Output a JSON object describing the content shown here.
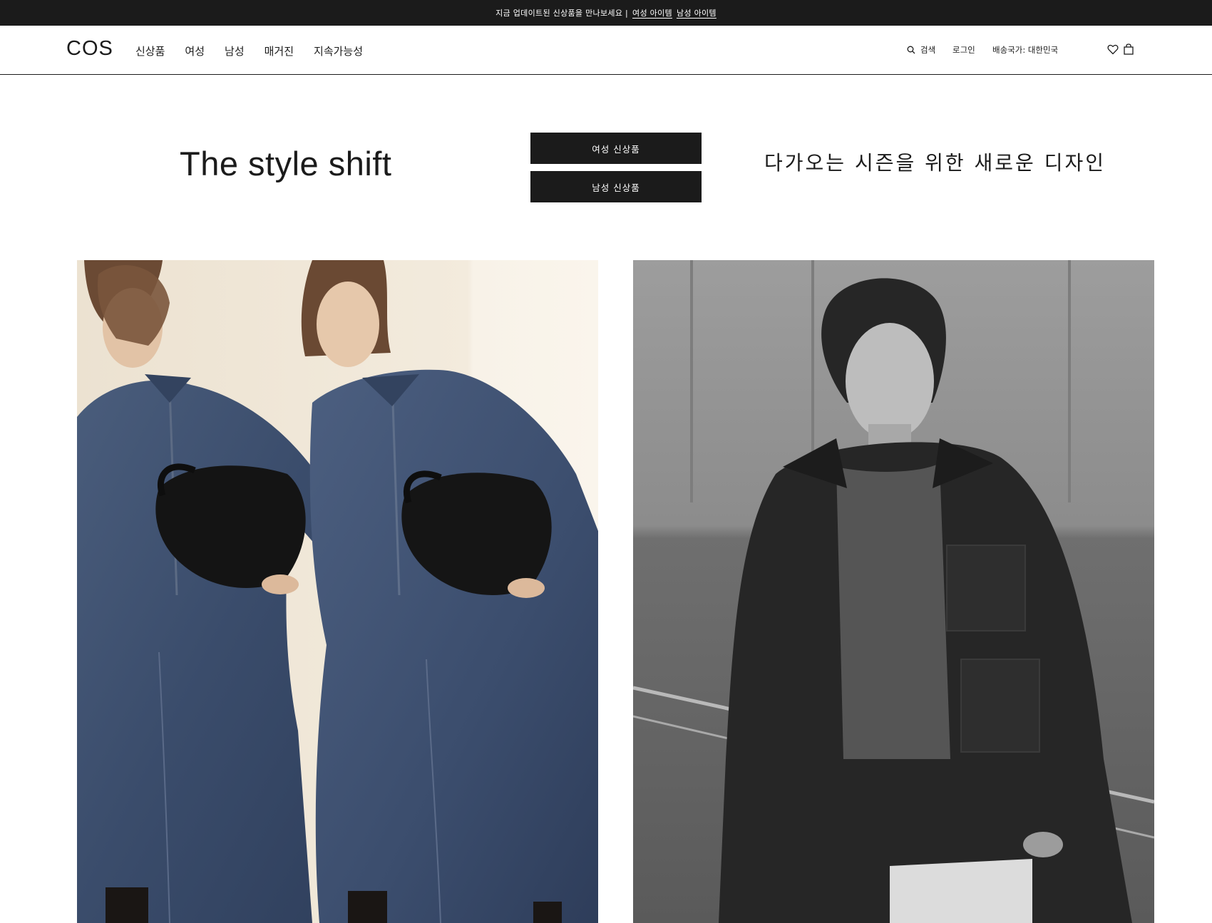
{
  "announcement": {
    "text": "지금 업데이트된 신상품을 만나보세요 |",
    "women_link": "여성 아이템",
    "men_link": "남성 아이템"
  },
  "header": {
    "logo": "COS",
    "nav": [
      "신상품",
      "여성",
      "남성",
      "매거진",
      "지속가능성"
    ],
    "search_label": "검색",
    "login_label": "로그인",
    "country_label": "배송국가: 대한민국",
    "icons": [
      "search-icon",
      "heart-icon",
      "bag-icon"
    ]
  },
  "hero": {
    "title": "The style shift",
    "women_button": "여성 신상품",
    "men_button": "남성 신상품",
    "subtitle": "다가오는 시즌을 위한 새로운 디자인"
  },
  "colors": {
    "ink": "#1b1b1b",
    "background": "#ffffff",
    "denim": "#3d5070",
    "cream": "#f1e8d9"
  }
}
